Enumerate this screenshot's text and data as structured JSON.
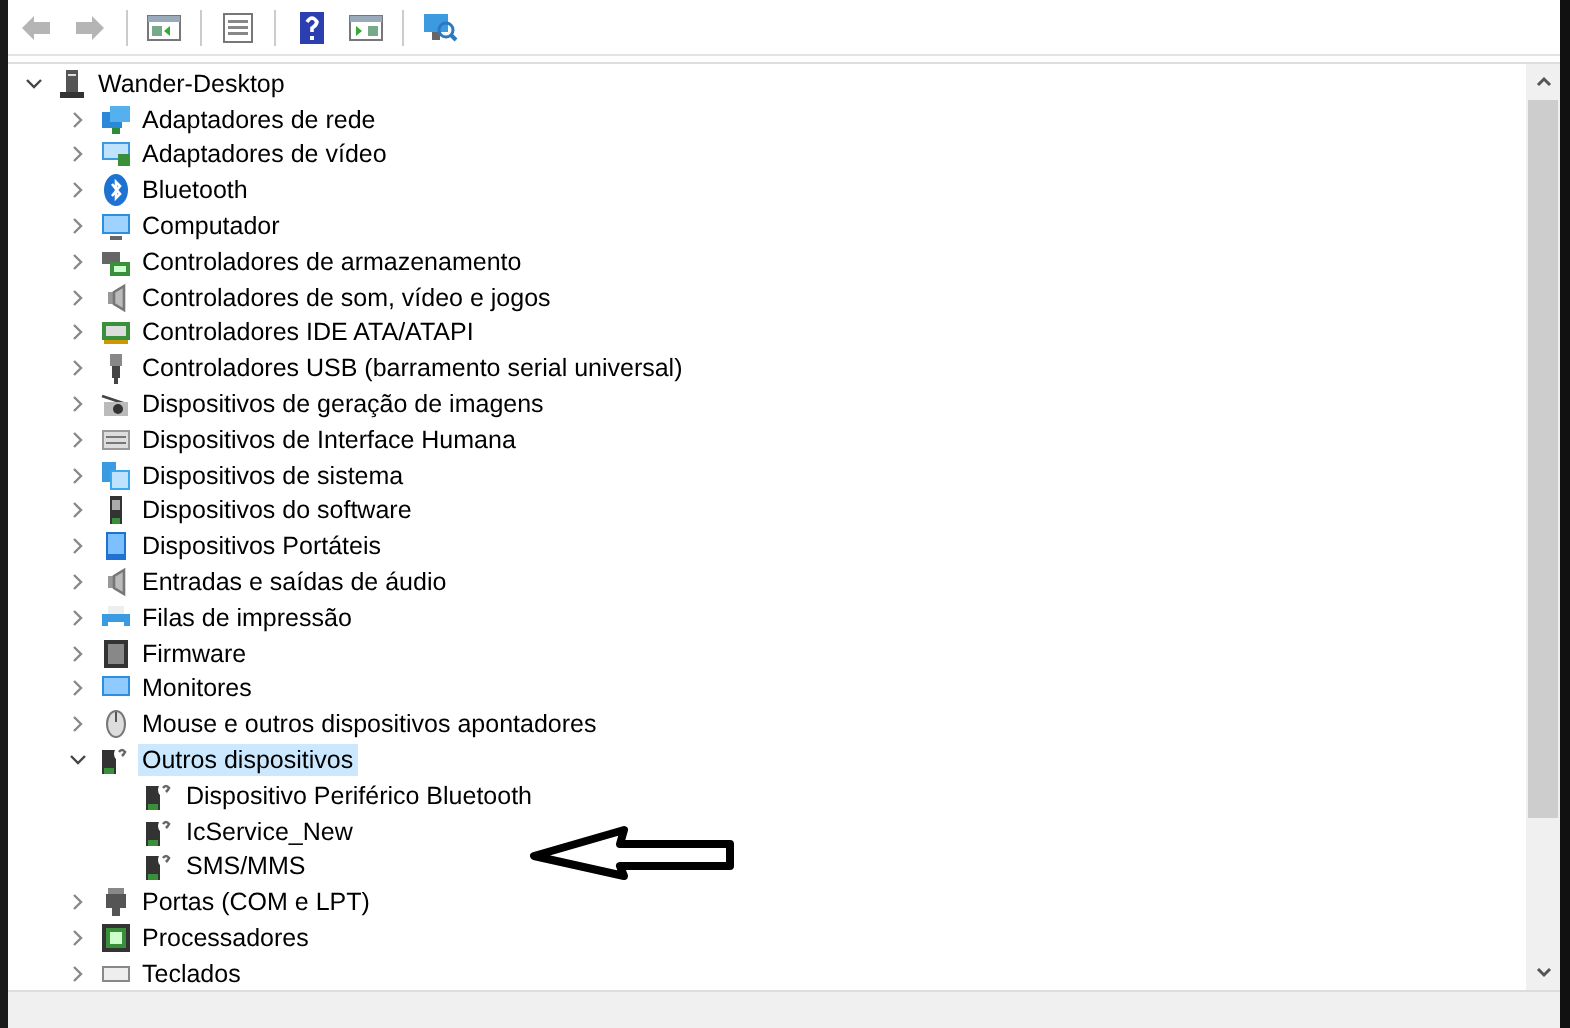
{
  "toolbar": {
    "buttons": [
      {
        "kind": "back",
        "disabled": true
      },
      {
        "kind": "forward",
        "disabled": true
      },
      {
        "kind": "separator"
      },
      {
        "kind": "console-tree"
      },
      {
        "kind": "separator"
      },
      {
        "kind": "properties"
      },
      {
        "kind": "separator"
      },
      {
        "kind": "help"
      },
      {
        "kind": "action-pane"
      },
      {
        "kind": "separator"
      },
      {
        "kind": "scan"
      }
    ]
  },
  "tree": {
    "label": "Wander-Desktop",
    "kind": "desktop",
    "expanded": true,
    "selected": false,
    "children": [
      {
        "label": "Adaptadores de rede",
        "kind": "network",
        "expanded": false,
        "selected": false
      },
      {
        "label": "Adaptadores de vídeo",
        "kind": "display",
        "expanded": false,
        "selected": false
      },
      {
        "label": "Bluetooth",
        "kind": "bluetooth",
        "expanded": false,
        "selected": false
      },
      {
        "label": "Computador",
        "kind": "computer",
        "expanded": false,
        "selected": false
      },
      {
        "label": "Controladores de armazenamento",
        "kind": "storage",
        "expanded": false,
        "selected": false
      },
      {
        "label": "Controladores de som, vídeo e jogos",
        "kind": "sound",
        "expanded": false,
        "selected": false
      },
      {
        "label": "Controladores IDE ATA/ATAPI",
        "kind": "ide",
        "expanded": false,
        "selected": false
      },
      {
        "label": "Controladores USB (barramento serial universal)",
        "kind": "usb",
        "expanded": false,
        "selected": false
      },
      {
        "label": "Dispositivos de geração de imagens",
        "kind": "imaging",
        "expanded": false,
        "selected": false
      },
      {
        "label": "Dispositivos de Interface Humana",
        "kind": "hid",
        "expanded": false,
        "selected": false
      },
      {
        "label": "Dispositivos de sistema",
        "kind": "system",
        "expanded": false,
        "selected": false
      },
      {
        "label": "Dispositivos do software",
        "kind": "software",
        "expanded": false,
        "selected": false
      },
      {
        "label": "Dispositivos Portáteis",
        "kind": "portable",
        "expanded": false,
        "selected": false
      },
      {
        "label": "Entradas e saídas de áudio",
        "kind": "sound",
        "expanded": false,
        "selected": false
      },
      {
        "label": "Filas de impressão",
        "kind": "printer",
        "expanded": false,
        "selected": false
      },
      {
        "label": "Firmware",
        "kind": "firmware",
        "expanded": false,
        "selected": false
      },
      {
        "label": "Monitores",
        "kind": "monitor",
        "expanded": false,
        "selected": false
      },
      {
        "label": "Mouse e outros dispositivos apontadores",
        "kind": "mouse",
        "expanded": false,
        "selected": false
      },
      {
        "label": "Outros dispositivos",
        "kind": "unknown",
        "expanded": true,
        "selected": true,
        "children": [
          {
            "label": "Dispositivo Periférico Bluetooth",
            "kind": "unknown",
            "selected": false
          },
          {
            "label": "IcService_New",
            "kind": "unknown",
            "selected": false
          },
          {
            "label": "SMS/MMS",
            "kind": "unknown",
            "selected": false
          }
        ]
      },
      {
        "label": "Portas (COM e LPT)",
        "kind": "port",
        "expanded": false,
        "selected": false
      },
      {
        "label": "Processadores",
        "kind": "processor",
        "expanded": false,
        "selected": false
      },
      {
        "label": "Teclados",
        "kind": "keyboard",
        "expanded": false,
        "selected": false
      }
    ]
  }
}
